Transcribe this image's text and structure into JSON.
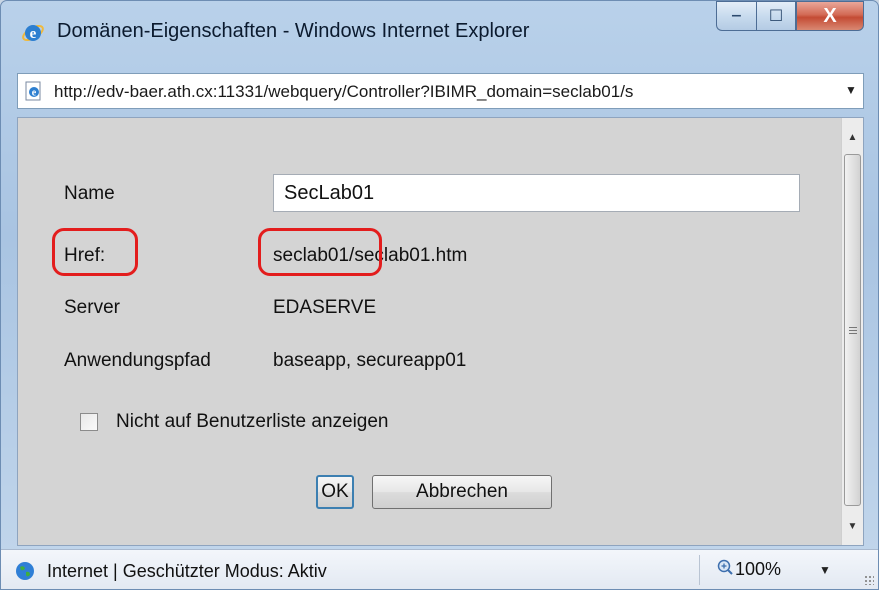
{
  "window": {
    "title": "Domänen-Eigenschaften - Windows Internet Explorer",
    "minimize_symbol": "‒",
    "maximize_symbol": "☐",
    "close_symbol": "X"
  },
  "address_bar": {
    "url": "http://edv-baer.ath.cx:11331/webquery/Controller?IBIMR_domain=seclab01/s"
  },
  "form": {
    "name_label": "Name",
    "name_value": "SecLab01",
    "href_label": "Href:",
    "href_value": "seclab01/seclab01.htm",
    "server_label": "Server",
    "server_value": "EDASERVE",
    "app_path_label": "Anwendungspfad",
    "app_path_value": "baseapp, secureapp01",
    "hide_checkbox_label": "Nicht auf Benutzerliste anzeigen",
    "hide_checkbox_checked": false
  },
  "buttons": {
    "ok_label": "OK",
    "cancel_label": "Abbrechen"
  },
  "status_bar": {
    "zone_text": "Internet | Geschützter Modus: Aktiv",
    "zoom_text": "100%"
  },
  "icons": {
    "title_icon": "ie-logo-icon",
    "page_icon": "ie-page-icon",
    "status_icon": "globe-icon",
    "zoom_icon": "zoom-icon"
  },
  "colors": {
    "annotation_red": "#e31d1d",
    "close_button": "#c44b34",
    "content_bg": "#d4d4d4"
  }
}
